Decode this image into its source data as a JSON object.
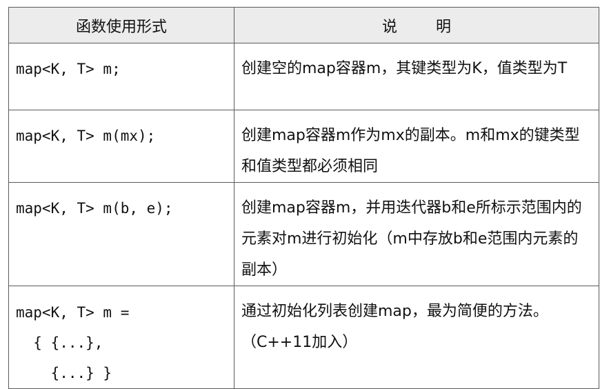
{
  "header": {
    "col1": "函数使用形式",
    "col2": "说        明"
  },
  "rows": [
    {
      "code": "map<K, T> m;",
      "desc": "创建空的map容器m，其键类型为K，值类型为T"
    },
    {
      "code": "map<K, T> m(mx);",
      "desc": "创建map容器m作为mx的副本。m和mx的键类型和值类型都必须相同"
    },
    {
      "code": "map<K, T> m(b, e);",
      "desc": "创建map容器m，并用迭代器b和e所标示范围内的元素对m进行初始化（m中存放b和e范围内元素的副本）"
    },
    {
      "code": "map<K, T> m =\n  { {...},\n    {...} }",
      "desc": "通过初始化列表创建map，最为简便的方法。（C++11加入）"
    }
  ]
}
